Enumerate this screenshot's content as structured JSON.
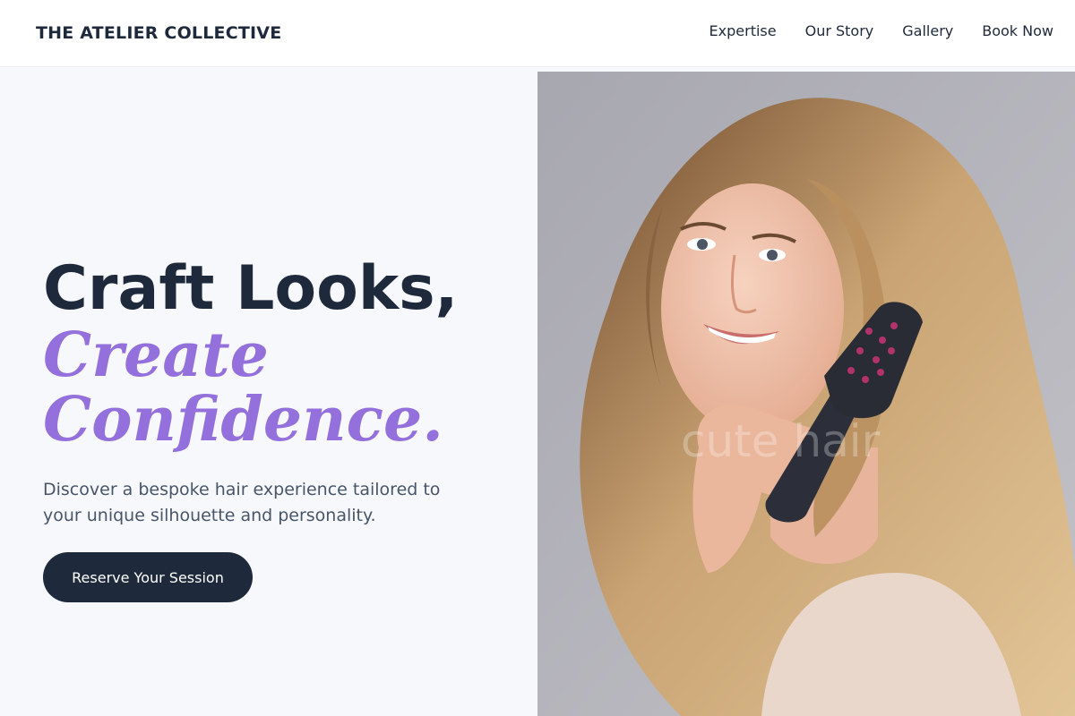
{
  "header": {
    "brand": "THE ATELIER COLLECTIVE",
    "nav": [
      "Expertise",
      "Our Story",
      "Gallery",
      "Book Now"
    ]
  },
  "hero": {
    "title_line1": "Craft Looks,",
    "title_accent_line1": "Create",
    "title_accent_line2": "Confidence.",
    "subtitle": "Discover a bespoke hair experience tailored to your unique silhouette and personality.",
    "cta_label": "Reserve Your Session",
    "photo_watermark": "cute hair"
  },
  "colors": {
    "accent": "#9370db",
    "dark": "#1e293b",
    "muted": "#475569",
    "page_bg": "#f7f8fc",
    "photo_bg": "#a9a9b2"
  }
}
